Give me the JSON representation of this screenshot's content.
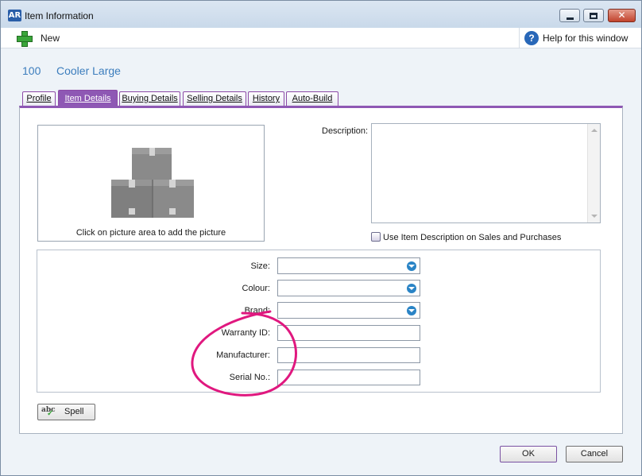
{
  "window": {
    "logo": "AR",
    "title": "Item Information"
  },
  "toolbar": {
    "new_label": "New",
    "help_icon_glyph": "?",
    "help_label": "Help for this window"
  },
  "item": {
    "number": "100",
    "name": "Cooler Large"
  },
  "tabs": [
    {
      "label": "Profile",
      "active": false
    },
    {
      "label": "Item Details",
      "active": true
    },
    {
      "label": "Buying Details",
      "active": false
    },
    {
      "label": "Selling Details",
      "active": false
    },
    {
      "label": "History",
      "active": false
    },
    {
      "label": "Auto-Build",
      "active": false
    }
  ],
  "picture": {
    "caption": "Click on picture area to add the picture",
    "icon": "boxes-icon"
  },
  "description": {
    "label": "Description:",
    "value": "",
    "use_on_sales_label": "Use Item Description on Sales and Purchases",
    "use_on_sales_checked": false
  },
  "fields": {
    "size": {
      "label": "Size:",
      "value": ""
    },
    "colour": {
      "label": "Colour:",
      "value": ""
    },
    "brand": {
      "label": "Brand:",
      "value": ""
    },
    "warranty_id": {
      "label": "Warranty ID:",
      "value": ""
    },
    "manufacturer": {
      "label": "Manufacturer:",
      "value": ""
    },
    "serial_no": {
      "label": "Serial No.:",
      "value": ""
    }
  },
  "buttons": {
    "spell": "Spell",
    "spell_icon_text": "abc",
    "ok": "OK",
    "cancel": "Cancel",
    "close_glyph": "✕"
  },
  "colors": {
    "accent_purple": "#8e58b4",
    "link_blue": "#3c7dbd",
    "annotation_pink": "#e0187f"
  }
}
